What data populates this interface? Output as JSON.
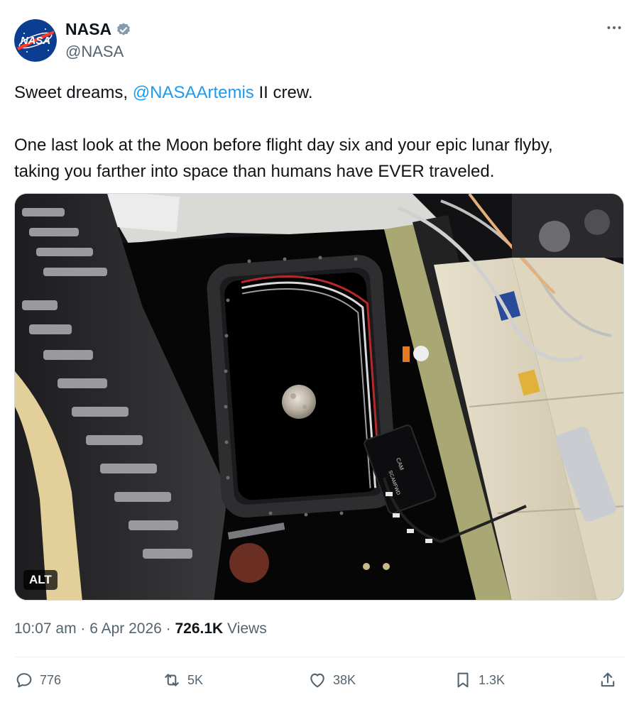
{
  "author": {
    "name": "NASA",
    "handle": "@NASA",
    "avatar_text": "NASA",
    "verified": true
  },
  "more_icon": "more-horizontal-icon",
  "post": {
    "line1_prefix": "Sweet dreams, ",
    "mention": "@NASAArtemis",
    "line1_suffix": " II crew.",
    "line2": "One last look at the Moon before flight day six and your epic lunar flyby,",
    "line3": "taking you farther into space than humans have EVER traveled."
  },
  "media": {
    "alt_label": "ALT",
    "labels": {
      "cam": "CAM",
      "scamfwd": "SCAMFWD"
    }
  },
  "meta": {
    "time": "10:07 am",
    "separator": " · ",
    "date": "6 Apr 2026",
    "views_count": "726.1K",
    "views_label": " Views"
  },
  "actions": {
    "replies": "776",
    "reposts": "5K",
    "likes": "38K",
    "bookmarks": "1.3K"
  },
  "colors": {
    "link": "#1d9bf0",
    "secondary_text": "#536471",
    "verified_badge": "#829aab"
  }
}
